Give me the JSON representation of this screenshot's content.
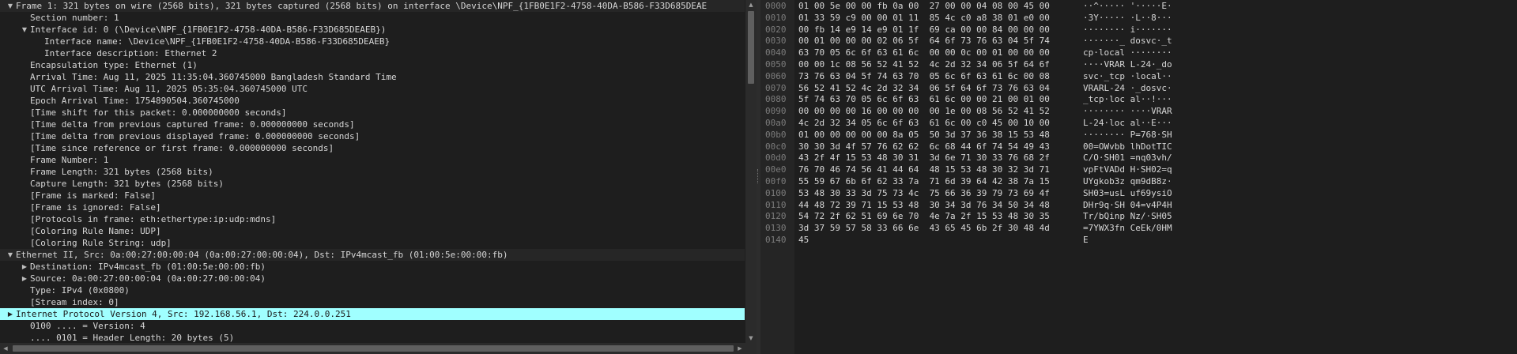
{
  "tree": [
    {
      "id": "frame-header",
      "text": "Frame 1: 321 bytes on wire (2568 bits), 321 bytes captured (2568 bits) on interface \\Device\\NPF_{1FB0E1F2-4758-40DA-B586-F33D685DEAE",
      "toggle": "expanded",
      "hdr": true
    },
    {
      "id": "section-number",
      "text": "Section number: 1"
    },
    {
      "id": "interface-id",
      "text": "Interface id: 0 (\\Device\\NPF_{1FB0E1F2-4758-40DA-B586-F33D685DEAEB})",
      "toggle": "expanded"
    },
    {
      "id": "interface-name",
      "text": "Interface name: \\Device\\NPF_{1FB0E1F2-4758-40DA-B586-F33D685DEAEB}"
    },
    {
      "id": "interface-description",
      "text": "Interface description: Ethernet 2"
    },
    {
      "id": "encapsulation-type",
      "text": "Encapsulation type: Ethernet (1)"
    },
    {
      "id": "arrival-time",
      "text": "Arrival Time: Aug 11, 2025 11:35:04.360745000 Bangladesh Standard Time"
    },
    {
      "id": "utc-arrival-time",
      "text": "UTC Arrival Time: Aug 11, 2025 05:35:04.360745000 UTC"
    },
    {
      "id": "epoch-arrival-time",
      "text": "Epoch Arrival Time: 1754890504.360745000"
    },
    {
      "id": "time-shift",
      "text": "[Time shift for this packet: 0.000000000 seconds]"
    },
    {
      "id": "time-delta-captured",
      "text": "[Time delta from previous captured frame: 0.000000000 seconds]"
    },
    {
      "id": "time-delta-displayed",
      "text": "[Time delta from previous displayed frame: 0.000000000 seconds]"
    },
    {
      "id": "time-since-reference",
      "text": "[Time since reference or first frame: 0.000000000 seconds]"
    },
    {
      "id": "frame-number",
      "text": "Frame Number: 1"
    },
    {
      "id": "frame-length",
      "text": "Frame Length: 321 bytes (2568 bits)"
    },
    {
      "id": "capture-length",
      "text": "Capture Length: 321 bytes (2568 bits)"
    },
    {
      "id": "frame-marked",
      "text": "[Frame is marked: False]"
    },
    {
      "id": "frame-ignored",
      "text": "[Frame is ignored: False]"
    },
    {
      "id": "protocols-in-frame",
      "text": "[Protocols in frame: eth:ethertype:ip:udp:mdns]"
    },
    {
      "id": "coloring-rule-name",
      "text": "[Coloring Rule Name: UDP]"
    },
    {
      "id": "coloring-rule-string",
      "text": "[Coloring Rule String: udp]"
    },
    {
      "id": "ethernet-header",
      "text": "Ethernet II, Src: 0a:00:27:00:00:04 (0a:00:27:00:00:04), Dst: IPv4mcast_fb (01:00:5e:00:00:fb)",
      "toggle": "expanded",
      "hdr": true
    },
    {
      "id": "eth-destination",
      "text": "Destination: IPv4mcast_fb (01:00:5e:00:00:fb)",
      "toggle": "collapsed"
    },
    {
      "id": "eth-source",
      "text": "Source: 0a:00:27:00:00:04 (0a:00:27:00:00:04)",
      "toggle": "collapsed"
    },
    {
      "id": "eth-type",
      "text": "Type: IPv4 (0x0800)"
    },
    {
      "id": "stream-index",
      "text": "[Stream index: 0]"
    },
    {
      "id": "ip-header",
      "text": "Internet Protocol Version 4, Src: 192.168.56.1, Dst: 224.0.0.251",
      "toggle": "collapsed",
      "selected": true
    },
    {
      "id": "ip-version",
      "text": "0100 .... = Version: 4"
    },
    {
      "id": "ip-header-length",
      "text": ".... 0101 = Header Length: 20 bytes (5)"
    }
  ],
  "tree_indent": [
    0,
    1,
    1,
    2,
    2,
    1,
    1,
    1,
    1,
    1,
    1,
    1,
    1,
    1,
    1,
    1,
    1,
    1,
    1,
    1,
    1,
    0,
    1,
    1,
    1,
    1,
    0,
    1,
    1
  ],
  "hex": [
    {
      "offset": "0000",
      "bytes": "01 00 5e 00 00 fb 0a 00  27 00 00 04 08 00 45 00",
      "ascii": "··^····· '·····E·"
    },
    {
      "offset": "0010",
      "bytes": "01 33 59 c9 00 00 01 11  85 4c c0 a8 38 01 e0 00",
      "ascii": "·3Y····· ·L··8···"
    },
    {
      "offset": "0020",
      "bytes": "00 fb 14 e9 14 e9 01 1f  69 ca 00 00 84 00 00 00",
      "ascii": "········ i·······"
    },
    {
      "offset": "0030",
      "bytes": "00 01 00 00 00 02 06 5f  64 6f 73 76 63 04 5f 74",
      "ascii": "·······_ dosvc·_t"
    },
    {
      "offset": "0040",
      "bytes": "63 70 05 6c 6f 63 61 6c  00 00 0c 00 01 00 00 00",
      "ascii": "cp·local ········"
    },
    {
      "offset": "0050",
      "bytes": "00 00 1c 08 56 52 41 52  4c 2d 32 34 06 5f 64 6f",
      "ascii": "····VRAR L-24·_do"
    },
    {
      "offset": "0060",
      "bytes": "73 76 63 04 5f 74 63 70  05 6c 6f 63 61 6c 00 08",
      "ascii": "svc·_tcp ·local··"
    },
    {
      "offset": "0070",
      "bytes": "56 52 41 52 4c 2d 32 34  06 5f 64 6f 73 76 63 04",
      "ascii": "VRARL-24 ·_dosvc·"
    },
    {
      "offset": "0080",
      "bytes": "5f 74 63 70 05 6c 6f 63  61 6c 00 00 21 00 01 00",
      "ascii": "_tcp·loc al··!···"
    },
    {
      "offset": "0090",
      "bytes": "00 00 00 00 16 00 00 00  00 1e 00 08 56 52 41 52",
      "ascii": "········ ····VRAR"
    },
    {
      "offset": "00a0",
      "bytes": "4c 2d 32 34 05 6c 6f 63  61 6c 00 c0 45 00 10 00",
      "ascii": "L-24·loc al··E···"
    },
    {
      "offset": "00b0",
      "bytes": "01 00 00 00 00 00 8a 05  50 3d 37 36 38 15 53 48",
      "ascii": "········ P=768·SH"
    },
    {
      "offset": "00c0",
      "bytes": "30 30 3d 4f 57 76 62 62  6c 68 44 6f 74 54 49 43",
      "ascii": "00=OWvbb lhDotTIC"
    },
    {
      "offset": "00d0",
      "bytes": "43 2f 4f 15 53 48 30 31  3d 6e 71 30 33 76 68 2f",
      "ascii": "C/O·SH01 =nq03vh/"
    },
    {
      "offset": "00e0",
      "bytes": "76 70 46 74 56 41 44 64  48 15 53 48 30 32 3d 71",
      "ascii": "vpFtVADd H·SH02=q"
    },
    {
      "offset": "00f0",
      "bytes": "55 59 67 6b 6f 62 33 7a  71 6d 39 64 42 38 7a 15",
      "ascii": "UYgkob3z qm9dB8z·"
    },
    {
      "offset": "0100",
      "bytes": "53 48 30 33 3d 75 73 4c  75 66 36 39 79 73 69 4f",
      "ascii": "SH03=usL uf69ysiO"
    },
    {
      "offset": "0110",
      "bytes": "44 48 72 39 71 15 53 48  30 34 3d 76 34 50 34 48",
      "ascii": "DHr9q·SH 04=v4P4H"
    },
    {
      "offset": "0120",
      "bytes": "54 72 2f 62 51 69 6e 70  4e 7a 2f 15 53 48 30 35",
      "ascii": "Tr/bQinp Nz/·SH05"
    },
    {
      "offset": "0130",
      "bytes": "3d 37 59 57 58 33 66 6e  43 65 45 6b 2f 30 48 4d",
      "ascii": "=7YWX3fn CeEk/0HM"
    },
    {
      "offset": "0140",
      "bytes": "45",
      "ascii": "E"
    }
  ],
  "colors": {
    "selected_row": "#a0ffff",
    "background": "#1e1e1e",
    "offset_text": "#7c7c7c"
  },
  "icons": {
    "expanded": "triangle-down-icon",
    "collapsed": "triangle-right-icon",
    "scroll_up": "arrow-up-icon",
    "scroll_down": "arrow-down-icon",
    "scroll_left": "arrow-left-icon",
    "scroll_right": "arrow-right-icon"
  }
}
